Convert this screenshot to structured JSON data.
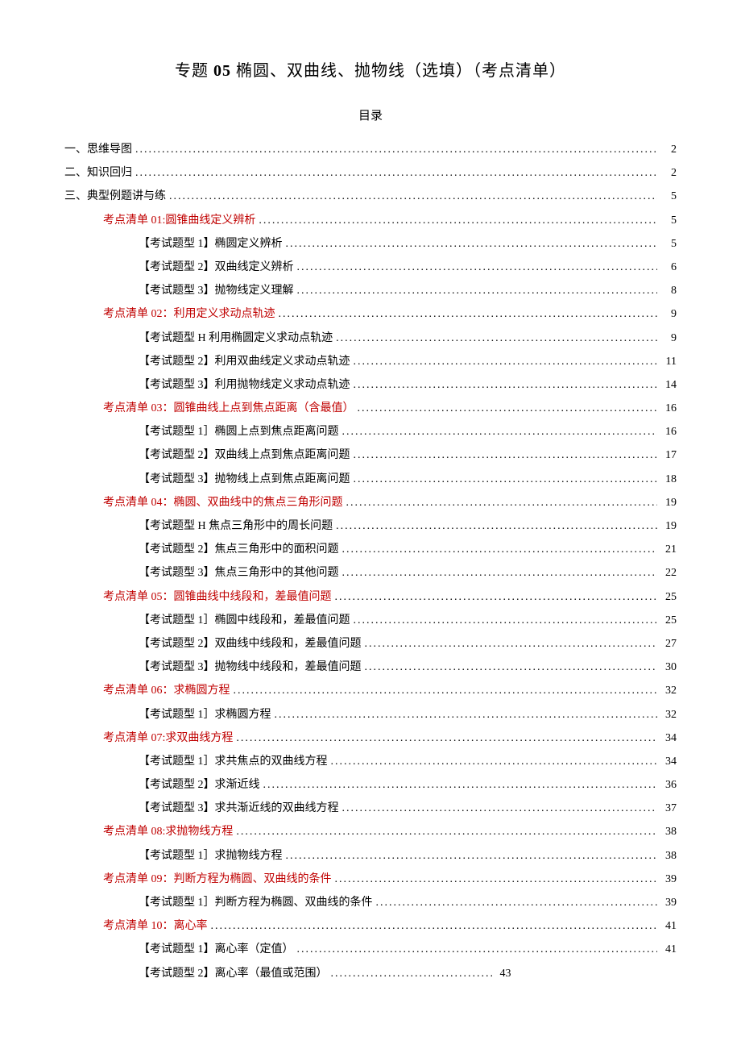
{
  "title_prefix": "专题",
  "title_number": "05",
  "title_rest": "椭圆、双曲线、抛物线（选填）（考点清单）",
  "subtitle": "目录",
  "toc": [
    {
      "level": 0,
      "red": false,
      "label": "一、思维导图",
      "page": "2"
    },
    {
      "level": 0,
      "red": false,
      "label": "二、知识回归",
      "page": "2"
    },
    {
      "level": 0,
      "red": false,
      "label": "三、典型例题讲与练",
      "page": "5"
    },
    {
      "level": 1,
      "red": true,
      "label": "考点清单 01:圆锥曲线定义辨析 ",
      "page": "5"
    },
    {
      "level": 2,
      "red": false,
      "label": "【考试题型 1】椭圆定义辨析",
      "page": "5"
    },
    {
      "level": 2,
      "red": false,
      "label": "【考试题型 2】双曲线定义辨析",
      "page": "6"
    },
    {
      "level": 2,
      "red": false,
      "label": "【考试题型 3】抛物线定义理解",
      "page": "8"
    },
    {
      "level": 1,
      "red": true,
      "label": "考点清单 02：利用定义求动点轨迹",
      "page": "9"
    },
    {
      "level": 2,
      "red": false,
      "label": "【考试题型 H 利用椭圆定义求动点轨迹 ",
      "page": "9"
    },
    {
      "level": 2,
      "red": false,
      "label": "【考试题型 2】利用双曲线定义求动点轨迹",
      "page": "11"
    },
    {
      "level": 2,
      "red": false,
      "label": "【考试题型 3】利用抛物线定义求动点轨迹",
      "page": "14"
    },
    {
      "level": 1,
      "red": true,
      "label": "考点清单 03：圆锥曲线上点到焦点距离（含最值） ",
      "page": "16"
    },
    {
      "level": 2,
      "red": false,
      "label": "【考试题型 1］椭圆上点到焦点距离问题 ",
      "page": "16"
    },
    {
      "level": 2,
      "red": false,
      "label": "【考试题型 2】双曲线上点到焦点距离问题",
      "page": "17"
    },
    {
      "level": 2,
      "red": false,
      "label": "【考试题型 3】抛物线上点到焦点距离问题",
      "page": "18"
    },
    {
      "level": 1,
      "red": true,
      "label": "考点清单 04：椭圆、双曲线中的焦点三角形问题 ",
      "page": "19"
    },
    {
      "level": 2,
      "red": false,
      "label": "【考试题型 H 焦点三角形中的周长问题 ",
      "page": "19"
    },
    {
      "level": 2,
      "red": false,
      "label": "【考试题型 2】焦点三角形中的面积问题",
      "page": "21"
    },
    {
      "level": 2,
      "red": false,
      "label": "【考试题型 3】焦点三角形中的其他问题",
      "page": "22"
    },
    {
      "level": 1,
      "red": true,
      "label": "考点清单 05：圆锥曲线中线段和，差最值问题 ",
      "page": "25"
    },
    {
      "level": 2,
      "red": false,
      "label": "【考试题型 1］椭圆中线段和，差最值问题",
      "page": "25"
    },
    {
      "level": 2,
      "red": false,
      "label": "【考试题型 2】双曲线中线段和，差最值问题",
      "page": "27"
    },
    {
      "level": 2,
      "red": false,
      "label": "【考试题型 3】抛物线中线段和，差最值问题",
      "page": "30"
    },
    {
      "level": 1,
      "red": true,
      "label": "考点清单 06：求椭圆方程 ",
      "page": "32"
    },
    {
      "level": 2,
      "red": false,
      "label": "【考试题型 1］求椭圆方程 ",
      "page": "32"
    },
    {
      "level": 1,
      "red": true,
      "label": "考点清单 07:求双曲线方程 ",
      "page": "34"
    },
    {
      "level": 2,
      "red": false,
      "label": "【考试题型 1］求共焦点的双曲线方程",
      "page": "34"
    },
    {
      "level": 2,
      "red": false,
      "label": "【考试题型 2】求渐近线",
      "page": "36"
    },
    {
      "level": 2,
      "red": false,
      "label": "【考试题型 3】求共渐近线的双曲线方程",
      "page": "37"
    },
    {
      "level": 1,
      "red": true,
      "label": "考点清单 08:求抛物线方程 ",
      "page": "38"
    },
    {
      "level": 2,
      "red": false,
      "label": "【考试题型 1］求抛物线方程",
      "page": "38"
    },
    {
      "level": 1,
      "red": true,
      "label": "考点清单 09：判断方程为椭圆、双曲线的条件 ",
      "page": "39"
    },
    {
      "level": 2,
      "red": false,
      "label": "【考试题型 1］判断方程为椭圆、双曲线的条件",
      "page": "39"
    },
    {
      "level": 1,
      "red": true,
      "label": "考点清单 10：离心率 ",
      "page": "41"
    },
    {
      "level": 2,
      "red": false,
      "label": "【考试题型 1】离心率（定值） ",
      "page": "41"
    },
    {
      "level": 2,
      "red": false,
      "label": "【考试题型 2】离心率（最值或范围） ",
      "page": "43",
      "short": true
    }
  ]
}
